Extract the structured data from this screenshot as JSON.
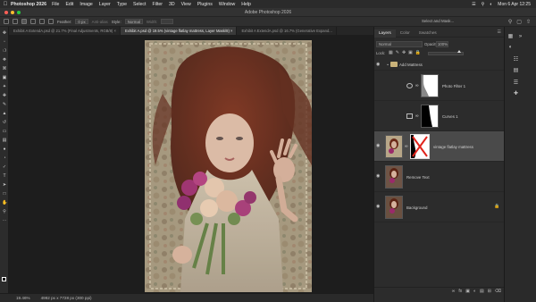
{
  "menubar": {
    "apple": "",
    "app_name": "Photoshop 2026",
    "items": [
      "File",
      "Edit",
      "Image",
      "Layer",
      "Type",
      "Select",
      "Filter",
      "3D",
      "View",
      "Plugins",
      "Window",
      "Help"
    ],
    "clock": "Mon 6 Apr  12:25"
  },
  "window": {
    "title": "Adobe Photoshop 2026"
  },
  "options_bar": {
    "feather_label": "Feather:",
    "feather_value": "0 px",
    "antialias_label": "Anti-alias",
    "style_label": "Style:",
    "style_value": "Normal",
    "width_label": "Width:",
    "select_mask": "Select and Mask..."
  },
  "tabs": [
    {
      "label": "Exhibit A ExtendA.psd @ 21.7% (Final Adjustments, RGB/8)",
      "active": false
    },
    {
      "label": "Exhibit A.psd @ 19.5% (vintage flatlay mattress, Layer Mask/8)",
      "active": true
    },
    {
      "label": "Exhibit A ExtendA.psd @ 16.7% (Generative Expand...",
      "active": false
    }
  ],
  "status": {
    "zoom": "19.46%",
    "doc_info": "4992 px x 7728 px (300 ppi)"
  },
  "panel": {
    "tabs": [
      "Layers",
      "Color",
      "Swatches"
    ],
    "blend_mode": "Normal",
    "opacity_label": "Opacity:",
    "opacity_value": "100%",
    "lock_label": "Lock:",
    "fill_label": "Fill:",
    "fill_level": 0.9
  },
  "layers": [
    {
      "name": "Add Mattress",
      "kind": "group",
      "visible": true,
      "selected": false
    },
    {
      "name": "Photo Filter 1",
      "kind": "adjustment",
      "visible": false,
      "selected": false
    },
    {
      "name": "Curves 1",
      "kind": "adjustment",
      "visible": false,
      "selected": false
    },
    {
      "name": "vintage flatlay mattress",
      "kind": "pixel-masked",
      "visible": true,
      "selected": true
    },
    {
      "name": "Remove Text",
      "kind": "pixel",
      "visible": true,
      "selected": false
    },
    {
      "name": "Background",
      "kind": "background",
      "visible": true,
      "selected": false
    }
  ],
  "colors": {
    "accent": "#4a90e2",
    "selected_row": "#4a4a4a",
    "panel_bg": "#2c2c2c",
    "canvas_bg": "#1d1d1d",
    "mask_red": "#e0241c"
  }
}
